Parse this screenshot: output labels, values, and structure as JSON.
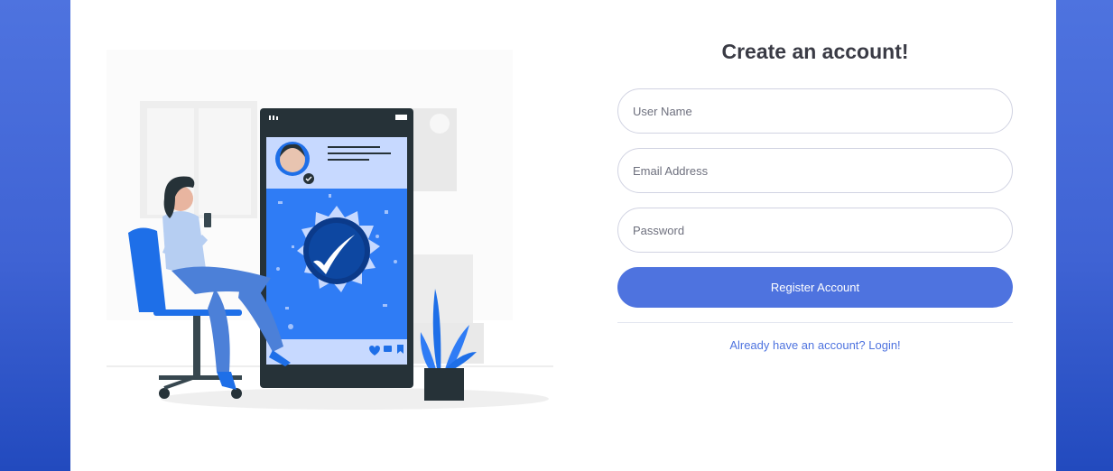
{
  "form": {
    "title": "Create an account!",
    "username_placeholder": "User Name",
    "email_placeholder": "Email Address",
    "password_placeholder": "Password",
    "register_label": "Register Account",
    "login_link_label": "Already have an account? Login!"
  },
  "colors": {
    "primary": "#4e73df",
    "text_dark": "#3a3b45",
    "muted": "#6e707e",
    "border": "#d1d3e2"
  },
  "icons": [
    "verified-badge-icon",
    "checkmark-icon",
    "heart-icon",
    "comment-icon",
    "bookmark-icon"
  ]
}
